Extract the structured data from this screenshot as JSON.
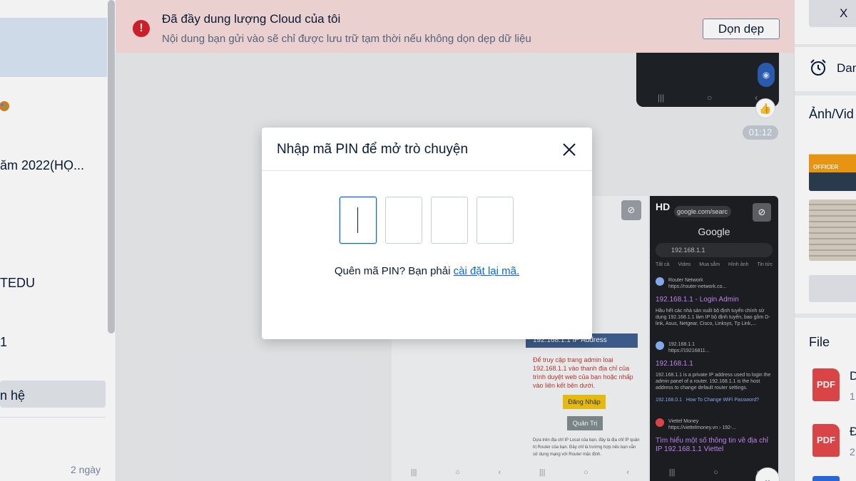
{
  "left_panel": {
    "conversations": [
      {
        "name": "",
        "selected": true
      },
      {
        "name": "ăm 2022(HỌ..."
      },
      {
        "name": "TEDU"
      },
      {
        "name": "1"
      },
      {
        "name": "n hệ"
      }
    ],
    "last_time": "2 ngày"
  },
  "alert": {
    "icon": "exclamation-icon",
    "title": "Đã đầy dung lượng Cloud của tôi",
    "description": "Nội dung bạn gửi vào sẽ chỉ được lưu trữ tạm thời nếu không dọn dẹp dữ liệu",
    "button_label": "Dọn dẹp",
    "color": "#d8212b"
  },
  "chat": {
    "message_time": "01:12",
    "hd_badge": "HD",
    "screenshot_light": {
      "box_title": "192.168.1.1 IP Address",
      "desc": "Để truy cập trang admin loại 192.168.1.1 vào thanh địa chỉ của trình duyệt web của bạn hoặc nhấp vào liên kết bên dưới.",
      "login_button": "Đăng Nhập",
      "admin_button": "Quản Trị",
      "fine_print": "Dựa trên địa chỉ IP Local của bạn, đây là địa chỉ IP quản trị Router của bạn. Đây chỉ là trường hợp nếu bạn vẫn sử dụng mạng với Router mặc định."
    },
    "screenshot_dark": {
      "url": "google.com/searc",
      "logo": "Google",
      "query": "192.168.1.1",
      "tabs": [
        "Tất cả",
        "Video",
        "Mua sắm",
        "Hình ảnh",
        "Tin tức"
      ],
      "results": [
        {
          "site": "Router Network",
          "url": "https://router-network.co...",
          "title": "192.168.1.1 - Login Admin",
          "snippet": "Hầu hết các nhà sản xuất bộ định tuyến chính sử dụng 192.168.1.1 làm IP bộ định tuyến, bao gồm D-link, Asus, Netgear, Cisco, Linksys, Tp Link,..."
        },
        {
          "site": "192.168.1.1",
          "url": "https://19216811...",
          "title": "192.168.1.1",
          "snippet": "192.168.1.1 is a private IP address used to login the admin panel of a router. 192.168.1.1 is the host address to change default router settings."
        },
        {
          "site": "Viettel Money",
          "url": "https://viettelmoney.vn › 192-...",
          "title": "Tìm hiểu một số thông tin về địa chỉ IP 192.168.1.1 Viettel",
          "snippet": ""
        }
      ],
      "links": [
        "192.168.0.1",
        "How To Change WiFi Password?"
      ]
    }
  },
  "right_panel": {
    "top_button_label": "X",
    "reminder_label": "Dan",
    "media_title": "Ảnh/Vid",
    "thumb1_label": "OFFICER",
    "files_title": "File",
    "files": [
      {
        "type": "PDF",
        "name": "D",
        "meta": "1."
      },
      {
        "type": "PDF",
        "name": "Đ",
        "meta": "2"
      }
    ]
  },
  "modal": {
    "title": "Nhập mã PIN để mở trò chuyện",
    "pin_digits": [
      "",
      "",
      "",
      ""
    ],
    "forgot_text": "Quên mã PIN? Bạn phải ",
    "reset_link": "cài đặt lại mã."
  }
}
